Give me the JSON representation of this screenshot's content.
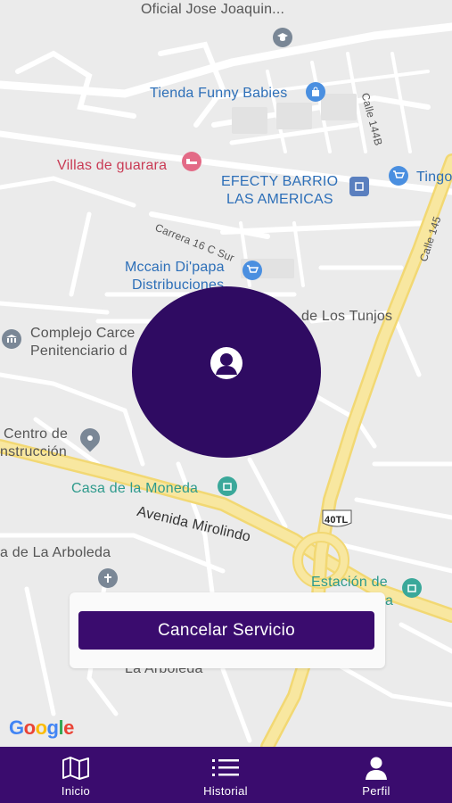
{
  "map": {
    "labels": {
      "school": "Oficial Jose Joaquin...",
      "store_babies": "Tienda Funny Babies",
      "villas": "Villas de guarara",
      "efecty_1": "EFECTY BARRIO",
      "efecty_2": "LAS AMERICAS",
      "tingo": "Tingo",
      "mccain_1": "Mccain Di'papa",
      "mccain_2": "Distribuciones",
      "complejo_1": "Complejo Carce",
      "complejo_2": "Penitenciario d",
      "tunjos": "de Los Tunjos",
      "centro_1": "Centro de",
      "centro_2": "nstrucción",
      "moneda": "Casa de la Moneda",
      "avenida": "Avenida Mirolindo",
      "arboleda": "a de La Arboleda",
      "estacion": "Estación de",
      "estacion_2": "a",
      "arboleda_2": "La Arboleda",
      "calle_144b": "Calle 144B",
      "calle_145": "Calle 145",
      "carrera": "Carrera 16 C Sur",
      "route": "40TL"
    },
    "attribution": "Google"
  },
  "service": {
    "cancel_label": "Cancelar Servicio"
  },
  "tabs": [
    {
      "label": "Inicio",
      "icon": "map-icon"
    },
    {
      "label": "Historial",
      "icon": "list-icon"
    },
    {
      "label": "Perfil",
      "icon": "person-icon"
    }
  ],
  "colors": {
    "primary": "#3a0c6e",
    "circle": "#2f0b62",
    "road_major": "#f5e08a",
    "map_bg": "#ebebeb"
  }
}
